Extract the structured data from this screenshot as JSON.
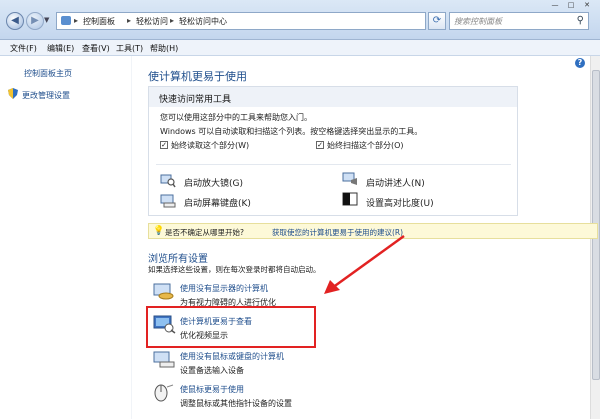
{
  "address": {
    "path": [
      "控制面板",
      "轻松访问",
      "轻松访问中心"
    ],
    "search_placeholder": "搜索控制面板"
  },
  "menu": [
    "文件(F)",
    "编辑(E)",
    "查看(V)",
    "工具(T)",
    "帮助(H)"
  ],
  "left_pane": {
    "home_link": "控制面板主页",
    "admin_link": "更改管理设置"
  },
  "main": {
    "heading": "使计算机更易于使用",
    "quick": {
      "title": "快速访问常用工具",
      "desc1": "您可以使用这部分中的工具来帮助您入门。",
      "desc2": "Windows 可以自动读取和扫描这个列表。按空格键选择突出显示的工具。",
      "check_read": "始终读取这个部分(W)",
      "check_scan": "始终扫描这个部分(O)",
      "tools": [
        "启动放大镜(G)",
        "启动讲述人(N)",
        "启动屏幕键盘(K)",
        "设置高对比度(U)"
      ]
    },
    "hint": {
      "prefix": "是否不确定从哪里开始?",
      "link": "获取使您的计算机更易于使用的建议(R)"
    },
    "browse": {
      "heading": "浏览所有设置",
      "subtitle": "如果选择这些设置，则在每次登录时都将自动启动。",
      "options": [
        {
          "title": "使用没有显示器的计算机",
          "desc": "为有视力障碍的人进行优化"
        },
        {
          "title": "使计算机更易于查看",
          "desc": "优化视频显示"
        },
        {
          "title": "使用没有鼠标或键盘的计算机",
          "desc": "设置备选输入设备"
        },
        {
          "title": "使鼠标更易于使用",
          "desc": "调整鼠标或其他指针设备的设置"
        }
      ]
    }
  },
  "colors": {
    "link": "#1f4e8c",
    "highlight_box": "#e22222",
    "hint_bg": "#fdf9d8"
  }
}
